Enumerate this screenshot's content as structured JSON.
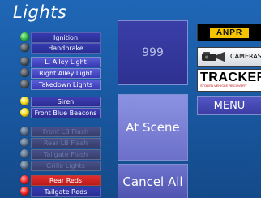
{
  "screen": {
    "title": "Lights"
  },
  "lights": [
    {
      "label": "Ignition",
      "led": "green",
      "style": "plain"
    },
    {
      "label": "Handbrake",
      "led": "dark",
      "style": "plain"
    },
    {
      "label": "L. Alley Light",
      "led": "dark",
      "style": "lbl"
    },
    {
      "label": "Right Alley Light",
      "led": "dark",
      "style": "lbl"
    },
    {
      "label": "Takedown Lights",
      "led": "dark",
      "style": "lbl"
    },
    {
      "label": "Siren",
      "led": "yellow",
      "style": "yel"
    },
    {
      "label": "Front Blue Beacons",
      "led": "yellow",
      "style": "yel"
    },
    {
      "label": "Front LB Flash",
      "led": "off",
      "style": "grey"
    },
    {
      "label": "Rear LB Flash",
      "led": "off",
      "style": "grey"
    },
    {
      "label": "Tailgate Flash",
      "led": "off",
      "style": "grey"
    },
    {
      "label": "Grille Lights",
      "led": "off",
      "style": "grey"
    },
    {
      "label": "Rear Reds",
      "led": "red",
      "style": "redlbl"
    },
    {
      "label": "Tailgate Reds",
      "led": "red",
      "style": "reddark"
    }
  ],
  "actions": {
    "emergency_label": "999",
    "at_scene_label": "At Scene",
    "cancel_all_label": "Cancel All"
  },
  "logos": {
    "anpr": "ANPR",
    "cameras": "CAMERAS",
    "tracker_name": "TRACKER",
    "tracker_sub": "STOLEN VEHICLE RECOVERY"
  },
  "menu": {
    "label": "MENU"
  },
  "colors": {
    "screen_bg": "#1a5aa4",
    "led_green": "#39c24b",
    "led_yellow": "#ffe21f",
    "led_red": "#ff2b2b",
    "anpr_yellow": "#f5c400"
  }
}
